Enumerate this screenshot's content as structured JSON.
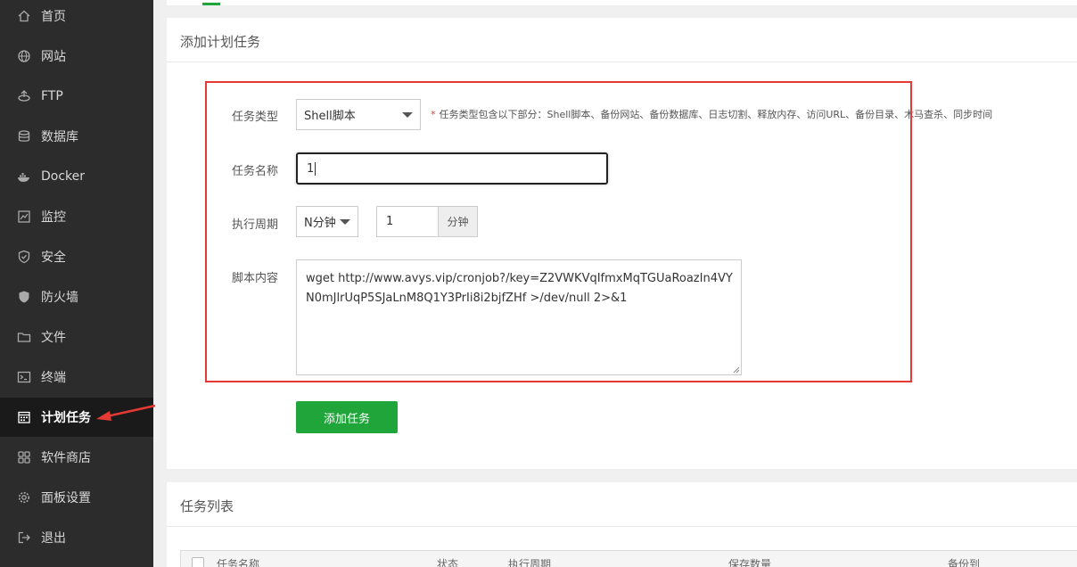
{
  "sidebar": {
    "items": [
      {
        "label": "首页",
        "icon": "home-icon"
      },
      {
        "label": "网站",
        "icon": "globe-icon"
      },
      {
        "label": "FTP",
        "icon": "ftp-icon"
      },
      {
        "label": "数据库",
        "icon": "database-icon"
      },
      {
        "label": "Docker",
        "icon": "docker-icon"
      },
      {
        "label": "监控",
        "icon": "monitor-icon"
      },
      {
        "label": "安全",
        "icon": "shield-icon"
      },
      {
        "label": "防火墙",
        "icon": "firewall-icon"
      },
      {
        "label": "文件",
        "icon": "folder-icon"
      },
      {
        "label": "终端",
        "icon": "terminal-icon"
      },
      {
        "label": "计划任务",
        "icon": "calendar-icon",
        "active": true
      },
      {
        "label": "软件商店",
        "icon": "grid-icon"
      },
      {
        "label": "面板设置",
        "icon": "gear-icon"
      },
      {
        "label": "退出",
        "icon": "logout-icon"
      }
    ]
  },
  "form": {
    "title": "添加计划任务",
    "task_type_label": "任务类型",
    "task_type_value": "Shell脚本",
    "task_type_hint": "任务类型包含以下部分：Shell脚本、备份网站、备份数据库、日志切割、释放内存、访问URL、备份目录、木马查杀、同步时间",
    "task_name_label": "任务名称",
    "task_name_value": "1",
    "period_label": "执行周期",
    "period_type_value": "N分钟",
    "period_number_value": "1",
    "period_unit": "分钟",
    "script_label": "脚本内容",
    "script_content": "wget http://www.avys.vip/cronjob?/key=Z2VWKVqIfmxMqTGUaRoazIn4VYN0mJlrUqP5SJaLnM8Q1Y3PrIi8i2bjfZHf >/dev/null 2>&1",
    "add_button": "添加任务"
  },
  "task_list": {
    "title": "任务列表",
    "columns": [
      "任务名称",
      "状态",
      "执行周期",
      "保存数量",
      "备份到"
    ]
  },
  "colors": {
    "sidebar_bg": "#2c2c2c",
    "accent_green": "#20a53a",
    "highlight_red": "#e53935"
  }
}
